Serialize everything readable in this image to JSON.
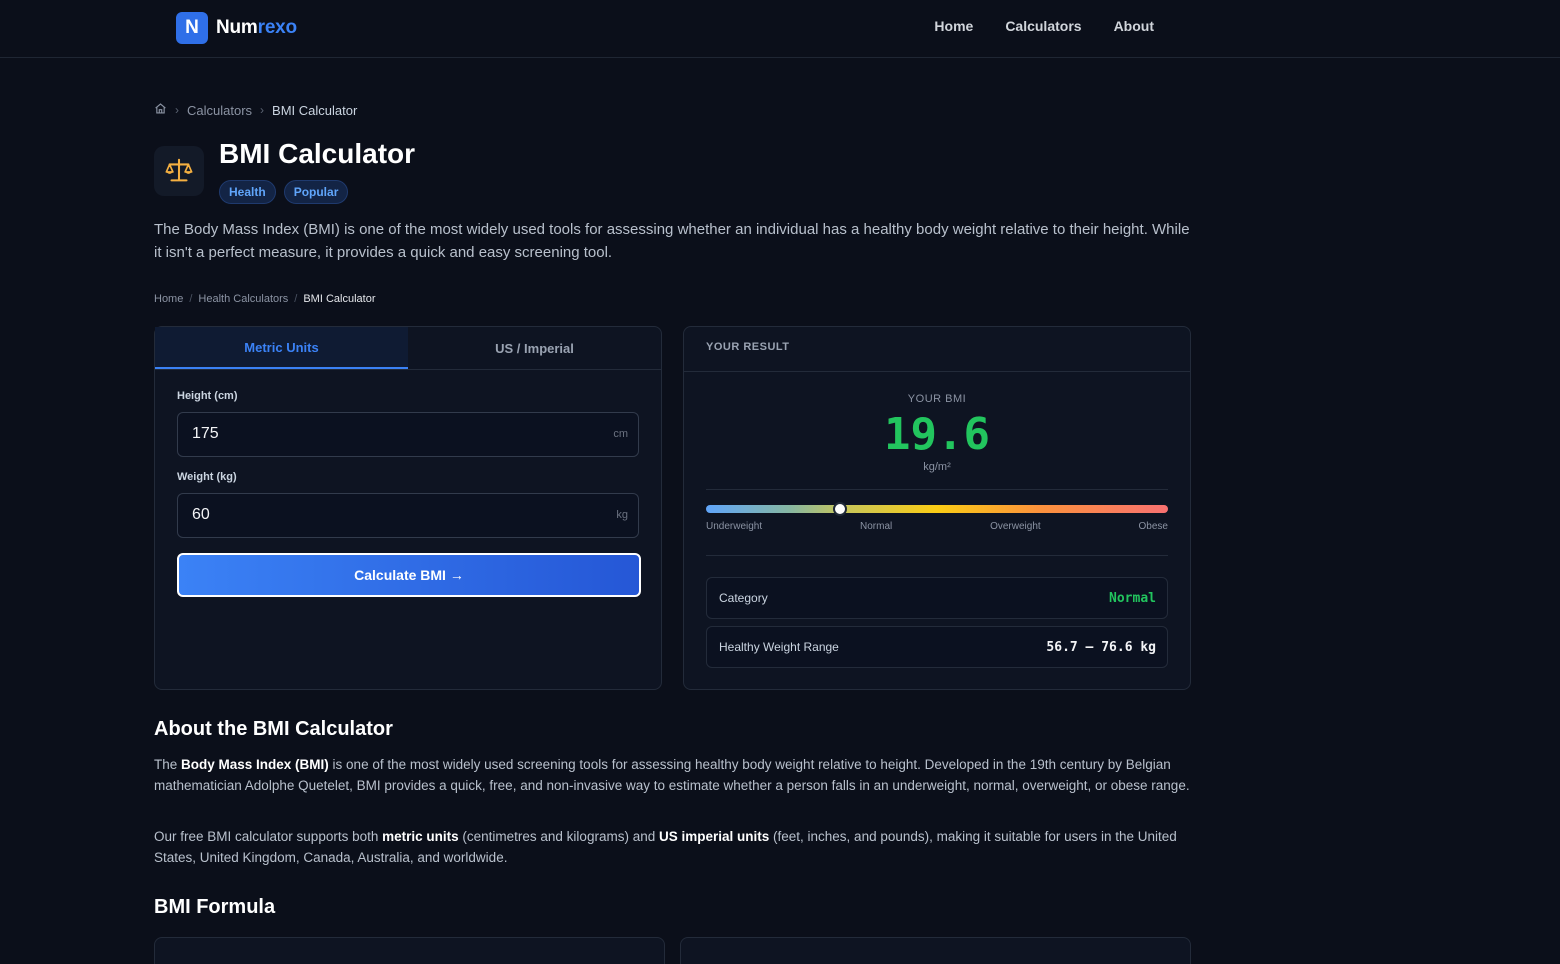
{
  "brand": {
    "prefix": "Num",
    "accent": "rexo",
    "logo_letter": "N"
  },
  "nav": {
    "home": "Home",
    "calculators": "Calculators",
    "about": "About"
  },
  "breadcrumb": {
    "calculators": "Calculators",
    "current": "BMI Calculator"
  },
  "header": {
    "title": "BMI Calculator",
    "badges": [
      "Health",
      "Popular"
    ]
  },
  "intro": "The Body Mass Index (BMI) is one of the most widely used tools for assessing whether an individual has a healthy body weight relative to their height. While it isn't a perfect measure, it provides a quick and easy screening tool.",
  "breadcrumb2": {
    "home": "Home",
    "section": "Health Calculators",
    "current": "BMI Calculator"
  },
  "calculator": {
    "tabs": [
      "Metric Units",
      "US / Imperial"
    ],
    "height_label": "Height (cm)",
    "height_value": "175",
    "height_unit": "cm",
    "weight_label": "Weight (kg)",
    "weight_value": "60",
    "weight_unit": "kg",
    "button": "Calculate BMI →"
  },
  "result": {
    "heading": "YOUR RESULT",
    "bmi_label": "YOUR BMI",
    "bmi_value": "19.6",
    "bmi_unit": "kg/m²",
    "scale_labels": [
      "Underweight",
      "Normal",
      "Overweight",
      "Obese"
    ],
    "indicator_fraction": 0.29,
    "category_label": "Category",
    "category_value": "Normal",
    "range_label": "Healthy Weight Range",
    "range_value": "56.7 – 76.6 kg"
  },
  "about": {
    "heading": "About the BMI Calculator",
    "p1_a": "The ",
    "p1_b": "Body Mass Index (BMI)",
    "p1_c": " is one of the most widely used screening tools for assessing healthy body weight relative to height. Developed in the 19th century by Belgian mathematician Adolphe Quetelet, BMI provides a quick, free, and non-invasive way to estimate whether a person falls in an underweight, normal, overweight, or obese range.",
    "p2_a": "Our free BMI calculator supports both ",
    "p2_b": "metric units",
    "p2_c": " (centimetres and kilograms) and ",
    "p2_d": "US imperial units",
    "p2_e": " (feet, inches, and pounds), making it suitable for users in the United States, United Kingdom, Canada, Australia, and worldwide."
  },
  "formula": {
    "heading": "BMI Formula"
  },
  "colors": {
    "accent": "#3b82f6",
    "success": "#22c55e",
    "background": "#0b0f1a"
  }
}
